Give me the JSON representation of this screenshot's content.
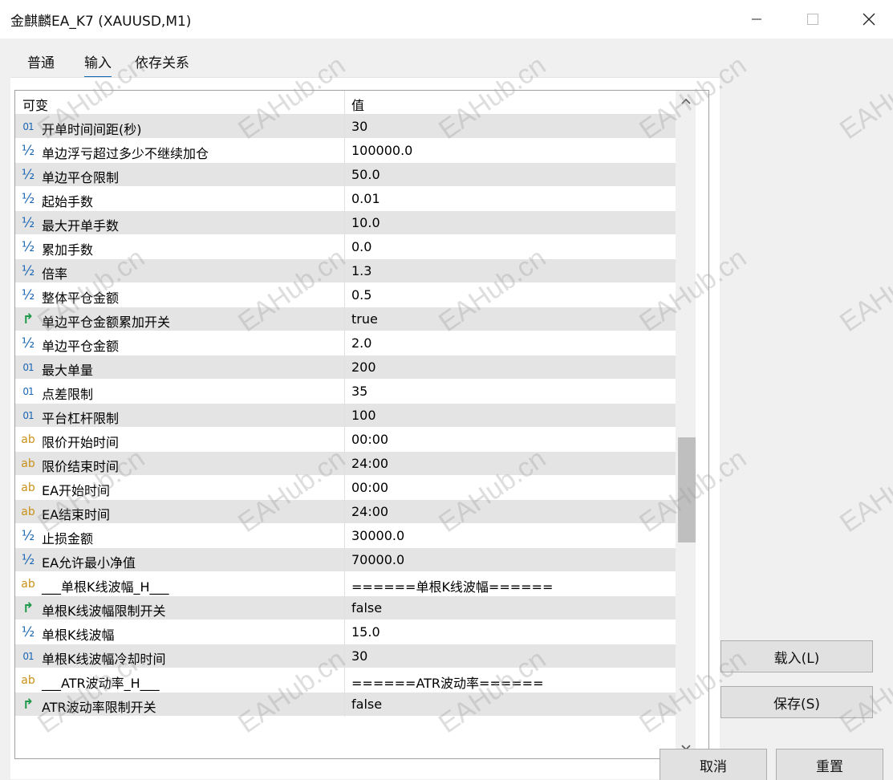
{
  "window": {
    "title": "金麒麟EA_K7 (XAUUSD,M1)",
    "minimize_icon": "minimize-icon",
    "maximize_icon": "maximize-icon",
    "close_icon": "close-icon"
  },
  "tabs": [
    {
      "label": "普通",
      "active": false
    },
    {
      "label": "输入",
      "active": true
    },
    {
      "label": "依存关系",
      "active": false
    }
  ],
  "grid": {
    "columns": [
      "可变",
      "值"
    ],
    "rows": [
      {
        "type": "int",
        "icon": "01",
        "name": "开单时间间距(秒)",
        "value": "30"
      },
      {
        "type": "double",
        "icon": "½",
        "name": "单边浮亏超过多少不继续加仓",
        "value": "100000.0"
      },
      {
        "type": "double",
        "icon": "½",
        "name": "单边平仓限制",
        "value": "50.0"
      },
      {
        "type": "double",
        "icon": "½",
        "name": "起始手数",
        "value": "0.01"
      },
      {
        "type": "double",
        "icon": "½",
        "name": "最大开单手数",
        "value": "10.0"
      },
      {
        "type": "double",
        "icon": "½",
        "name": "累加手数",
        "value": "0.0"
      },
      {
        "type": "double",
        "icon": "½",
        "name": "倍率",
        "value": "1.3"
      },
      {
        "type": "double",
        "icon": "½",
        "name": "整体平仓金额",
        "value": "0.5"
      },
      {
        "type": "bool",
        "icon": "↱",
        "name": "单边平仓金额累加开关",
        "value": "true"
      },
      {
        "type": "double",
        "icon": "½",
        "name": "单边平仓金额",
        "value": "2.0"
      },
      {
        "type": "int",
        "icon": "01",
        "name": "最大单量",
        "value": "200"
      },
      {
        "type": "int",
        "icon": "01",
        "name": "点差限制",
        "value": "35"
      },
      {
        "type": "int",
        "icon": "01",
        "name": "平台杠杆限制",
        "value": "100"
      },
      {
        "type": "string",
        "icon": "ab",
        "name": "限价开始时间",
        "value": "00:00"
      },
      {
        "type": "string",
        "icon": "ab",
        "name": "限价结束时间",
        "value": "24:00"
      },
      {
        "type": "string",
        "icon": "ab",
        "name": "EA开始时间",
        "value": "00:00"
      },
      {
        "type": "string",
        "icon": "ab",
        "name": "EA结束时间",
        "value": "24:00"
      },
      {
        "type": "double",
        "icon": "½",
        "name": "止损金额",
        "value": "30000.0"
      },
      {
        "type": "double",
        "icon": "½",
        "name": "EA允许最小净值",
        "value": "70000.0"
      },
      {
        "type": "string",
        "icon": "ab",
        "name": "___单根K线波幅_H___",
        "value": "======单根K线波幅======"
      },
      {
        "type": "bool",
        "icon": "↱",
        "name": "单根K线波幅限制开关",
        "value": "false"
      },
      {
        "type": "double",
        "icon": "½",
        "name": "单根K线波幅",
        "value": "15.0"
      },
      {
        "type": "int",
        "icon": "01",
        "name": "单根K线波幅冷却时间",
        "value": "30"
      },
      {
        "type": "string",
        "icon": "ab",
        "name": "___ATR波动率_H___",
        "value": "======ATR波动率======"
      },
      {
        "type": "bool",
        "icon": "↱",
        "name": "ATR波动率限制开关",
        "value": "false"
      }
    ],
    "scroll_up_icon": "chevron-up-icon",
    "scroll_down_icon": "chevron-down-icon"
  },
  "buttons": {
    "load": "载入(L)",
    "save": "保存(S)",
    "cancel": "取消",
    "reset": "重置"
  },
  "watermark": "EAHub.cn",
  "colors": {
    "tab_underline": "#0a64b4",
    "int_icon": "#1a66b5",
    "string_icon": "#c9911a",
    "bool_icon": "#1e9a4a",
    "row_shade": "#e4e4e4"
  }
}
